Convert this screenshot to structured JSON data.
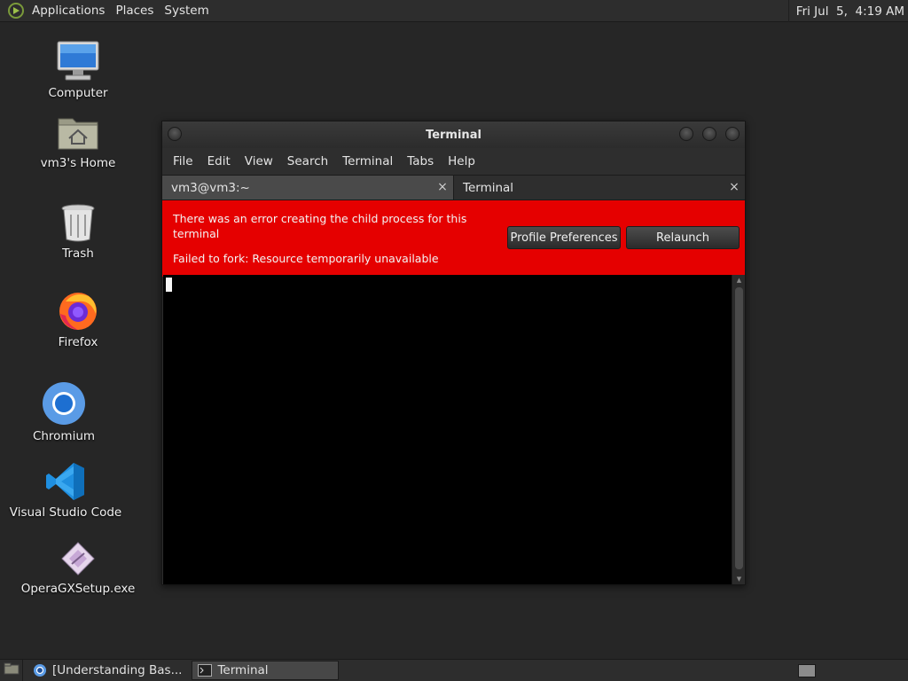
{
  "top_panel": {
    "menus": [
      "Applications",
      "Places",
      "System"
    ],
    "clock": "Fri Jul  5,  4:19 AM"
  },
  "desktop": {
    "icons": [
      {
        "label": "Computer",
        "icon": "computer-icon"
      },
      {
        "label": "vm3's Home",
        "icon": "home-folder-icon"
      },
      {
        "label": "Trash",
        "icon": "trash-icon"
      },
      {
        "label": "Firefox",
        "icon": "firefox-icon"
      },
      {
        "label": "Chromium",
        "icon": "chromium-icon"
      },
      {
        "label": "Visual Studio Code",
        "icon": "vscode-icon"
      },
      {
        "label": "OperaGXSetup.exe",
        "icon": "exe-file-icon"
      }
    ]
  },
  "terminal_window": {
    "title": "Terminal",
    "menu": [
      "File",
      "Edit",
      "View",
      "Search",
      "Terminal",
      "Tabs",
      "Help"
    ],
    "tabs": [
      {
        "label": "vm3@vm3:~",
        "active": true
      },
      {
        "label": "Terminal",
        "active": false
      }
    ],
    "close_glyph": "×",
    "error": {
      "message": "There was an error creating the child process for this terminal",
      "detail": "Failed to fork: Resource temporarily unavailable",
      "profile_button": "Profile Preferences",
      "relaunch_button": "Relaunch",
      "background": "#e50000"
    }
  },
  "bottom_panel": {
    "tasks": [
      {
        "label": "[Understanding Bas...",
        "icon": "chromium-icon",
        "active": false
      },
      {
        "label": "Terminal",
        "icon": "terminal-icon",
        "active": true
      }
    ]
  }
}
